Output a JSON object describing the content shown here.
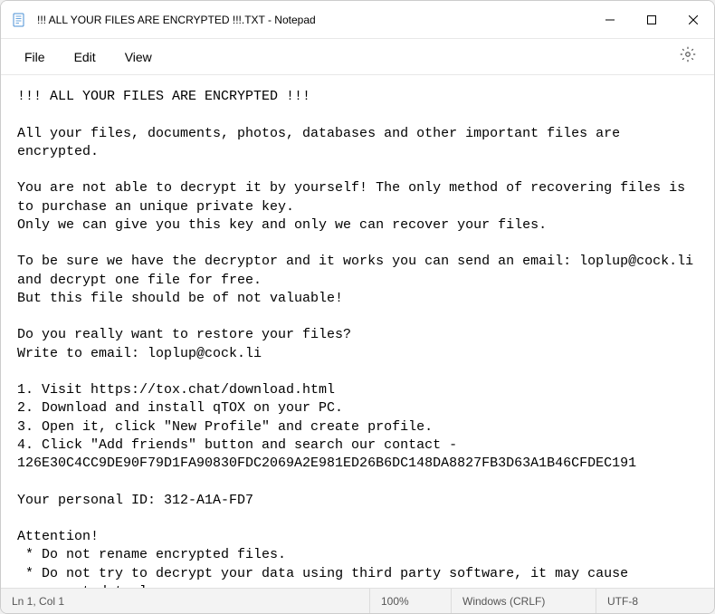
{
  "titlebar": {
    "title": "!!! ALL YOUR FILES ARE ENCRYPTED !!!.TXT - Notepad"
  },
  "menu": {
    "file": "File",
    "edit": "Edit",
    "view": "View"
  },
  "content": {
    "text": "!!! ALL YOUR FILES ARE ENCRYPTED !!!\n\nAll your files, documents, photos, databases and other important files are encrypted.\n\nYou are not able to decrypt it by yourself! The only method of recovering files is to purchase an unique private key.\nOnly we can give you this key and only we can recover your files.\n\nTo be sure we have the decryptor and it works you can send an email: loplup@cock.li and decrypt one file for free.\nBut this file should be of not valuable!\n\nDo you really want to restore your files?\nWrite to email: loplup@cock.li\n\n1. Visit https://tox.chat/download.html\n2. Download and install qTOX on your PC.\n3. Open it, click \"New Profile\" and create profile.\n4. Click \"Add friends\" button and search our contact -\n126E30C4CC9DE90F79D1FA90830FDC2069A2E981ED26B6DC148DA8827FB3D63A1B46CFDEC191\n\nYour personal ID: 312-A1A-FD7\n\nAttention!\n * Do not rename encrypted files.\n * Do not try to decrypt your data using third party software, it may cause permanent data loss.\n * Decryption of your files with the help of third parties may cause increased price (they add their fee to our) or you can become a victim of a scam."
  },
  "statusbar": {
    "position": "Ln 1, Col 1",
    "zoom": "100%",
    "lineend": "Windows (CRLF)",
    "encoding": "UTF-8"
  }
}
